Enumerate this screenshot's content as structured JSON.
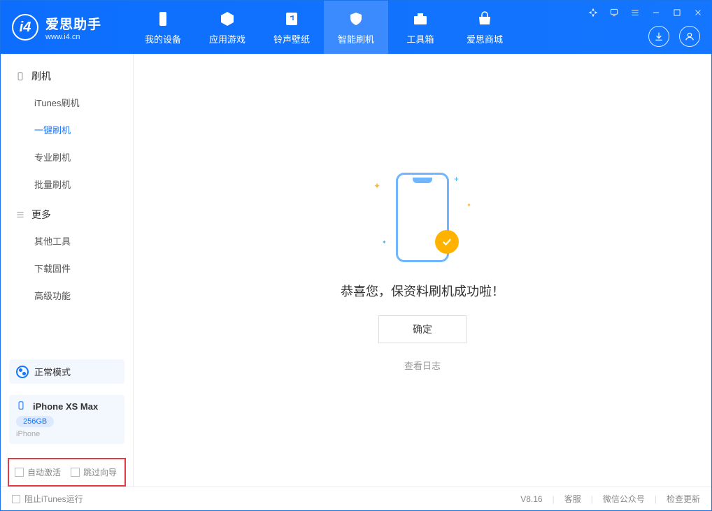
{
  "app": {
    "title": "爱思助手",
    "subtitle": "www.i4.cn"
  },
  "nav": {
    "items": [
      {
        "label": "我的设备"
      },
      {
        "label": "应用游戏"
      },
      {
        "label": "铃声壁纸"
      },
      {
        "label": "智能刷机"
      },
      {
        "label": "工具箱"
      },
      {
        "label": "爱思商城"
      }
    ]
  },
  "sidebar": {
    "section1": {
      "title": "刷机",
      "items": [
        {
          "label": "iTunes刷机"
        },
        {
          "label": "一键刷机"
        },
        {
          "label": "专业刷机"
        },
        {
          "label": "批量刷机"
        }
      ]
    },
    "section2": {
      "title": "更多",
      "items": [
        {
          "label": "其他工具"
        },
        {
          "label": "下载固件"
        },
        {
          "label": "高级功能"
        }
      ]
    },
    "mode": "正常模式",
    "device": {
      "name": "iPhone XS Max",
      "storage": "256GB",
      "type": "iPhone"
    },
    "options": {
      "auto_activate": "自动激活",
      "skip_guide": "跳过向导"
    }
  },
  "main": {
    "success_text": "恭喜您，保资料刷机成功啦！",
    "ok_button": "确定",
    "view_log": "查看日志"
  },
  "status": {
    "block_itunes": "阻止iTunes运行",
    "version": "V8.16",
    "links": {
      "support": "客服",
      "wechat": "微信公众号",
      "update": "检查更新"
    }
  }
}
